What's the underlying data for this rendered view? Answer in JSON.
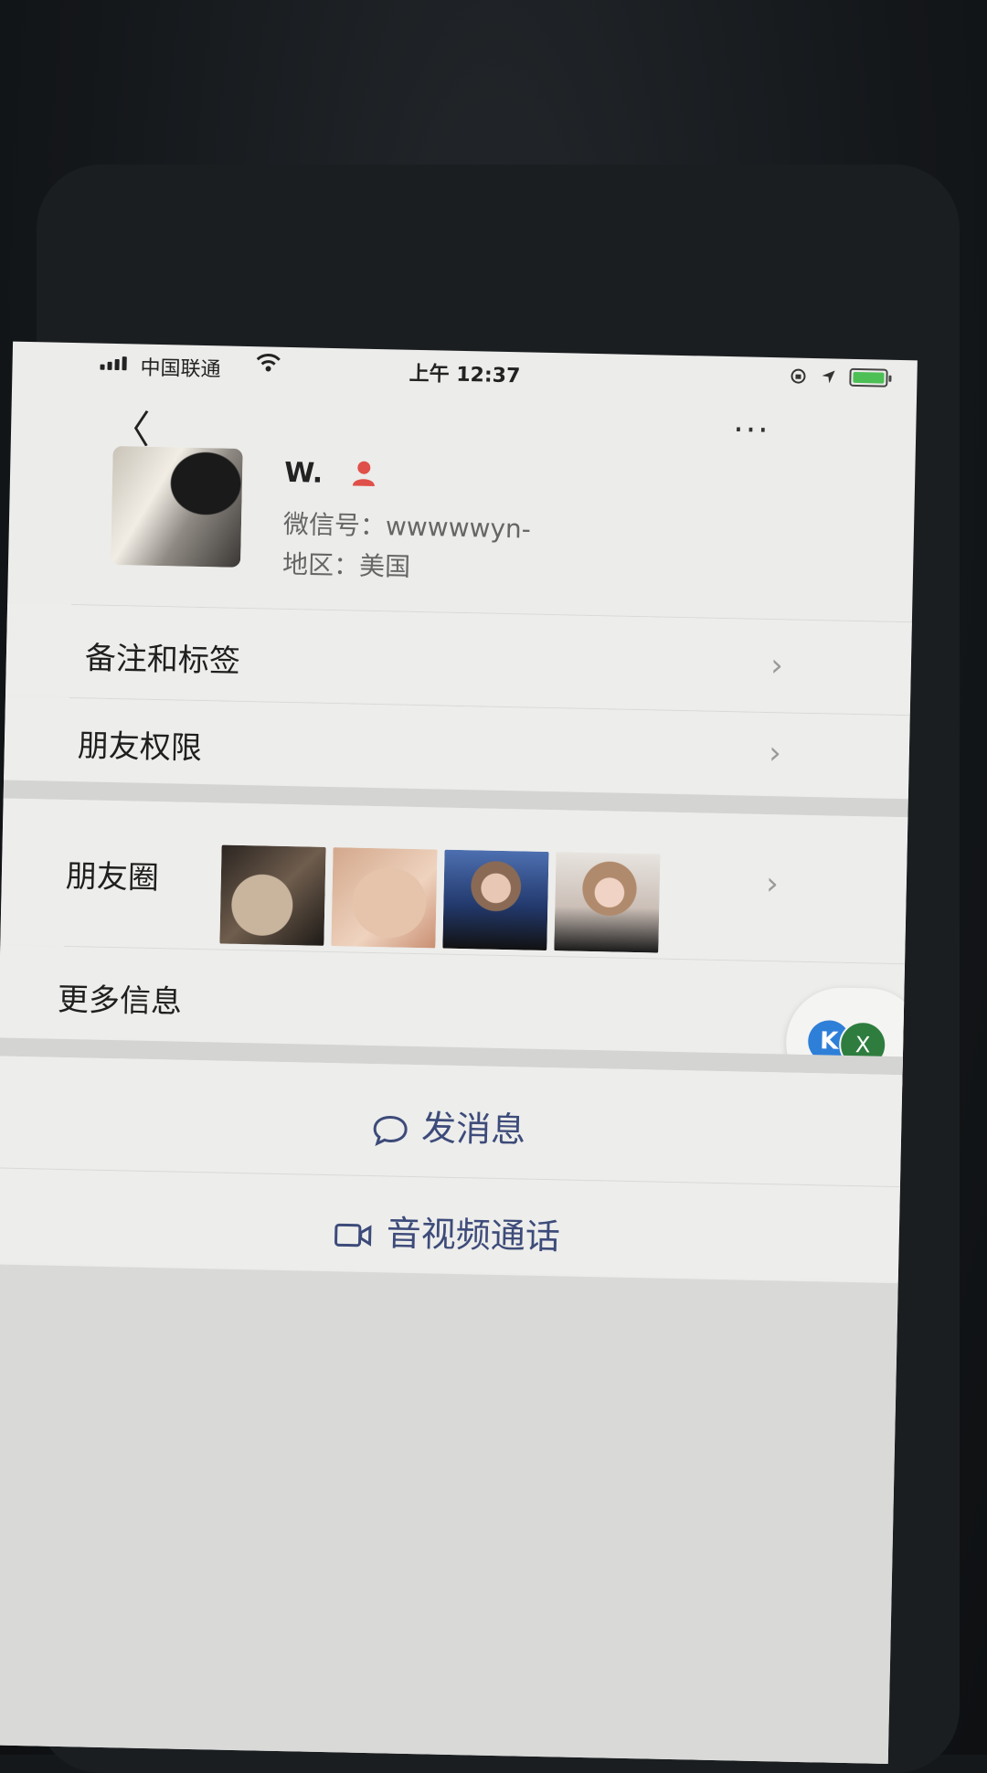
{
  "status_bar": {
    "carrier": "中国联通",
    "time": "上午 12:37"
  },
  "nav": {
    "back_icon": "chevron-left-icon",
    "back_glyph": "〈",
    "more_glyph": "···"
  },
  "profile": {
    "name": "W.",
    "wechat_id": "微信号：wwwwwyn-",
    "region": "地区：美国"
  },
  "rows": {
    "remark_tags": "备注和标签",
    "friend_permissions": "朋友权限",
    "moments": "朋友圈",
    "more_info": "更多信息"
  },
  "chevron": "›",
  "floating": {
    "badge_left": "K",
    "badge_right": "X"
  },
  "actions": {
    "message": "发消息",
    "call": "音视频通话"
  },
  "colors": {
    "background": "#ececea",
    "accent": "#3d4b7a",
    "contact_icon": "#e0504a",
    "battery": "#4cbf55"
  }
}
